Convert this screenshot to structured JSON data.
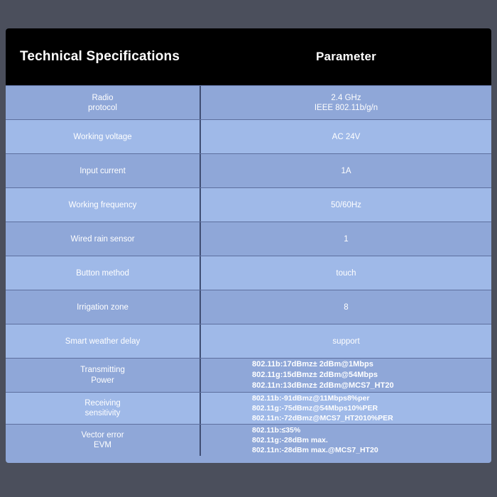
{
  "table": {
    "header": {
      "spec_column": "Technical Specifications",
      "parameter_column": "Parameter"
    },
    "rows": [
      {
        "label": "Radio\nprotocol",
        "value": "2.4 GHz\nIEEE 802.11b/g/n",
        "style": "simple"
      },
      {
        "label": "Working voltage",
        "value": "AC 24V",
        "style": "simple"
      },
      {
        "label": "Input current",
        "value": "1A",
        "style": "simple"
      },
      {
        "label": "Working frequency",
        "value": "50/60Hz",
        "style": "simple"
      },
      {
        "label": "Wired rain sensor",
        "value": "1",
        "style": "simple"
      },
      {
        "label": "Button method",
        "value": "touch",
        "style": "simple"
      },
      {
        "label": "Irrigation zone",
        "value": "8",
        "style": "simple"
      },
      {
        "label": "Smart weather delay",
        "value": "support",
        "style": "simple"
      },
      {
        "label": "Transmitting\nPower",
        "value": "802.11b:17dBmz± 2dBm@1Mbps\n802.11g:15dBmz± 2dBm@54Mbps\n802.11n:13dBmz± 2dBm@MCS7_HT20",
        "style": "dense"
      },
      {
        "label": "Receiving\nsensitivity",
        "value": "802.11b:-91dBmz@11Mbps8%per\n802.11g:-75dBmz@54Mbps10%PER\n802.11n:-72dBmz@MCS7_HT2010%PER",
        "style": "dense-tight"
      },
      {
        "label": "Vector error\nEVM",
        "value": "802.11b:≤35%\n802.11g:-28dBm max.\n802.11n:-28dBm max.@MCS7_HT20",
        "style": "dense-tight"
      }
    ]
  },
  "colors": {
    "page_background": "#4b4f5c",
    "header_background": "#000000",
    "row_shade_dark": "#8fa7d8",
    "row_shade_light": "#9fb9e8",
    "row_divider": "#5d6f9e",
    "column_divider": "#3f4d73",
    "text": "#ffffff"
  }
}
